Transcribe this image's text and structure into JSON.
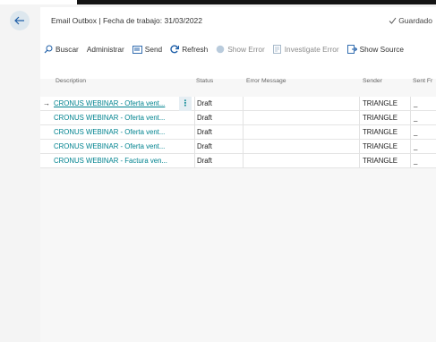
{
  "header": {
    "title": "Email Outbox | Fecha de trabajo: 31/03/2022",
    "saved_label": "Guardado"
  },
  "actions": [
    {
      "label": "Buscar",
      "icon": "search-icon",
      "enabled": true
    },
    {
      "label": "Administrar",
      "icon": "",
      "enabled": true
    },
    {
      "label": "Send",
      "icon": "send-icon",
      "enabled": true
    },
    {
      "label": "Refresh",
      "icon": "refresh-icon",
      "enabled": true
    },
    {
      "label": "Show Error",
      "icon": "error-icon",
      "enabled": false
    },
    {
      "label": "Investigate Error",
      "icon": "investigate-icon",
      "enabled": false
    },
    {
      "label": "Show Source",
      "icon": "source-icon",
      "enabled": true
    }
  ],
  "columns": {
    "description": "Description",
    "status": "Status",
    "error_message": "Error Message",
    "sender": "Sender",
    "sent_from": "Sent Fr"
  },
  "rows": [
    {
      "description": "CRONUS WEBINAR - Oferta vent...",
      "status": "Draft",
      "error_message": "",
      "sender": "TRIANGLE",
      "sent_from": "_"
    },
    {
      "description": "CRONUS WEBINAR - Oferta vent...",
      "status": "Draft",
      "error_message": "",
      "sender": "TRIANGLE",
      "sent_from": "_"
    },
    {
      "description": "CRONUS WEBINAR - Oferta vent...",
      "status": "Draft",
      "error_message": "",
      "sender": "TRIANGLE",
      "sent_from": "_"
    },
    {
      "description": "CRONUS WEBINAR - Oferta vent...",
      "status": "Draft",
      "error_message": "",
      "sender": "TRIANGLE",
      "sent_from": "_"
    },
    {
      "description": "CRONUS WEBINAR - Factura ven...",
      "status": "Draft",
      "error_message": "",
      "sender": "TRIANGLE",
      "sent_from": "_"
    }
  ],
  "row_arrow": "→",
  "row_menu": "⋮",
  "colors": {
    "link": "#00838f",
    "back_button_bg": "#dde7ee",
    "accent": "#0078d4"
  }
}
